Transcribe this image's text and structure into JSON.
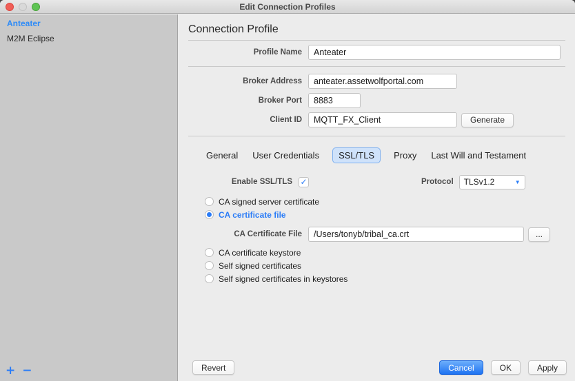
{
  "window": {
    "title": "Edit Connection Profiles"
  },
  "sidebar": {
    "items": [
      {
        "label": "Anteater",
        "selected": true
      },
      {
        "label": "M2M Eclipse",
        "selected": false
      }
    ],
    "add_label": "+",
    "remove_label": "−"
  },
  "main": {
    "heading": "Connection Profile",
    "fields": {
      "profile_name": {
        "label": "Profile Name",
        "value": "Anteater"
      },
      "broker_address": {
        "label": "Broker Address",
        "value": "anteater.assetwolfportal.com"
      },
      "broker_port": {
        "label": "Broker Port",
        "value": "8883"
      },
      "client_id": {
        "label": "Client ID",
        "value": "MQTT_FX_Client",
        "generate_label": "Generate"
      }
    },
    "tabs": [
      {
        "label": "General",
        "selected": false
      },
      {
        "label": "User Credentials",
        "selected": false
      },
      {
        "label": "SSL/TLS",
        "selected": true
      },
      {
        "label": "Proxy",
        "selected": false
      },
      {
        "label": "Last Will and Testament",
        "selected": false
      }
    ],
    "ssl": {
      "enable_label": "Enable SSL/TLS",
      "enabled": true,
      "check_glyph": "✓",
      "protocol_label": "Protocol",
      "protocol_value": "TLSv1.2",
      "caret_glyph": "▼",
      "options": [
        {
          "label": "CA signed server certificate",
          "selected": false
        },
        {
          "label": "CA certificate file",
          "selected": true
        },
        {
          "label": "CA certificate keystore",
          "selected": false
        },
        {
          "label": "Self signed certificates",
          "selected": false
        },
        {
          "label": "Self signed certificates in keystores",
          "selected": false
        }
      ],
      "ca_file": {
        "label": "CA Certificate File",
        "value": "/Users/tonyb/tribal_ca.crt",
        "browse_label": "..."
      }
    },
    "footer": {
      "revert_label": "Revert",
      "cancel_label": "Cancel",
      "ok_label": "OK",
      "apply_label": "Apply"
    }
  },
  "colors": {
    "accent_blue": "#2a7cf7",
    "selected_tab_bg": "#cfe2fa",
    "sidebar_bg": "#c9c9c9",
    "panel_bg": "#ececec"
  }
}
